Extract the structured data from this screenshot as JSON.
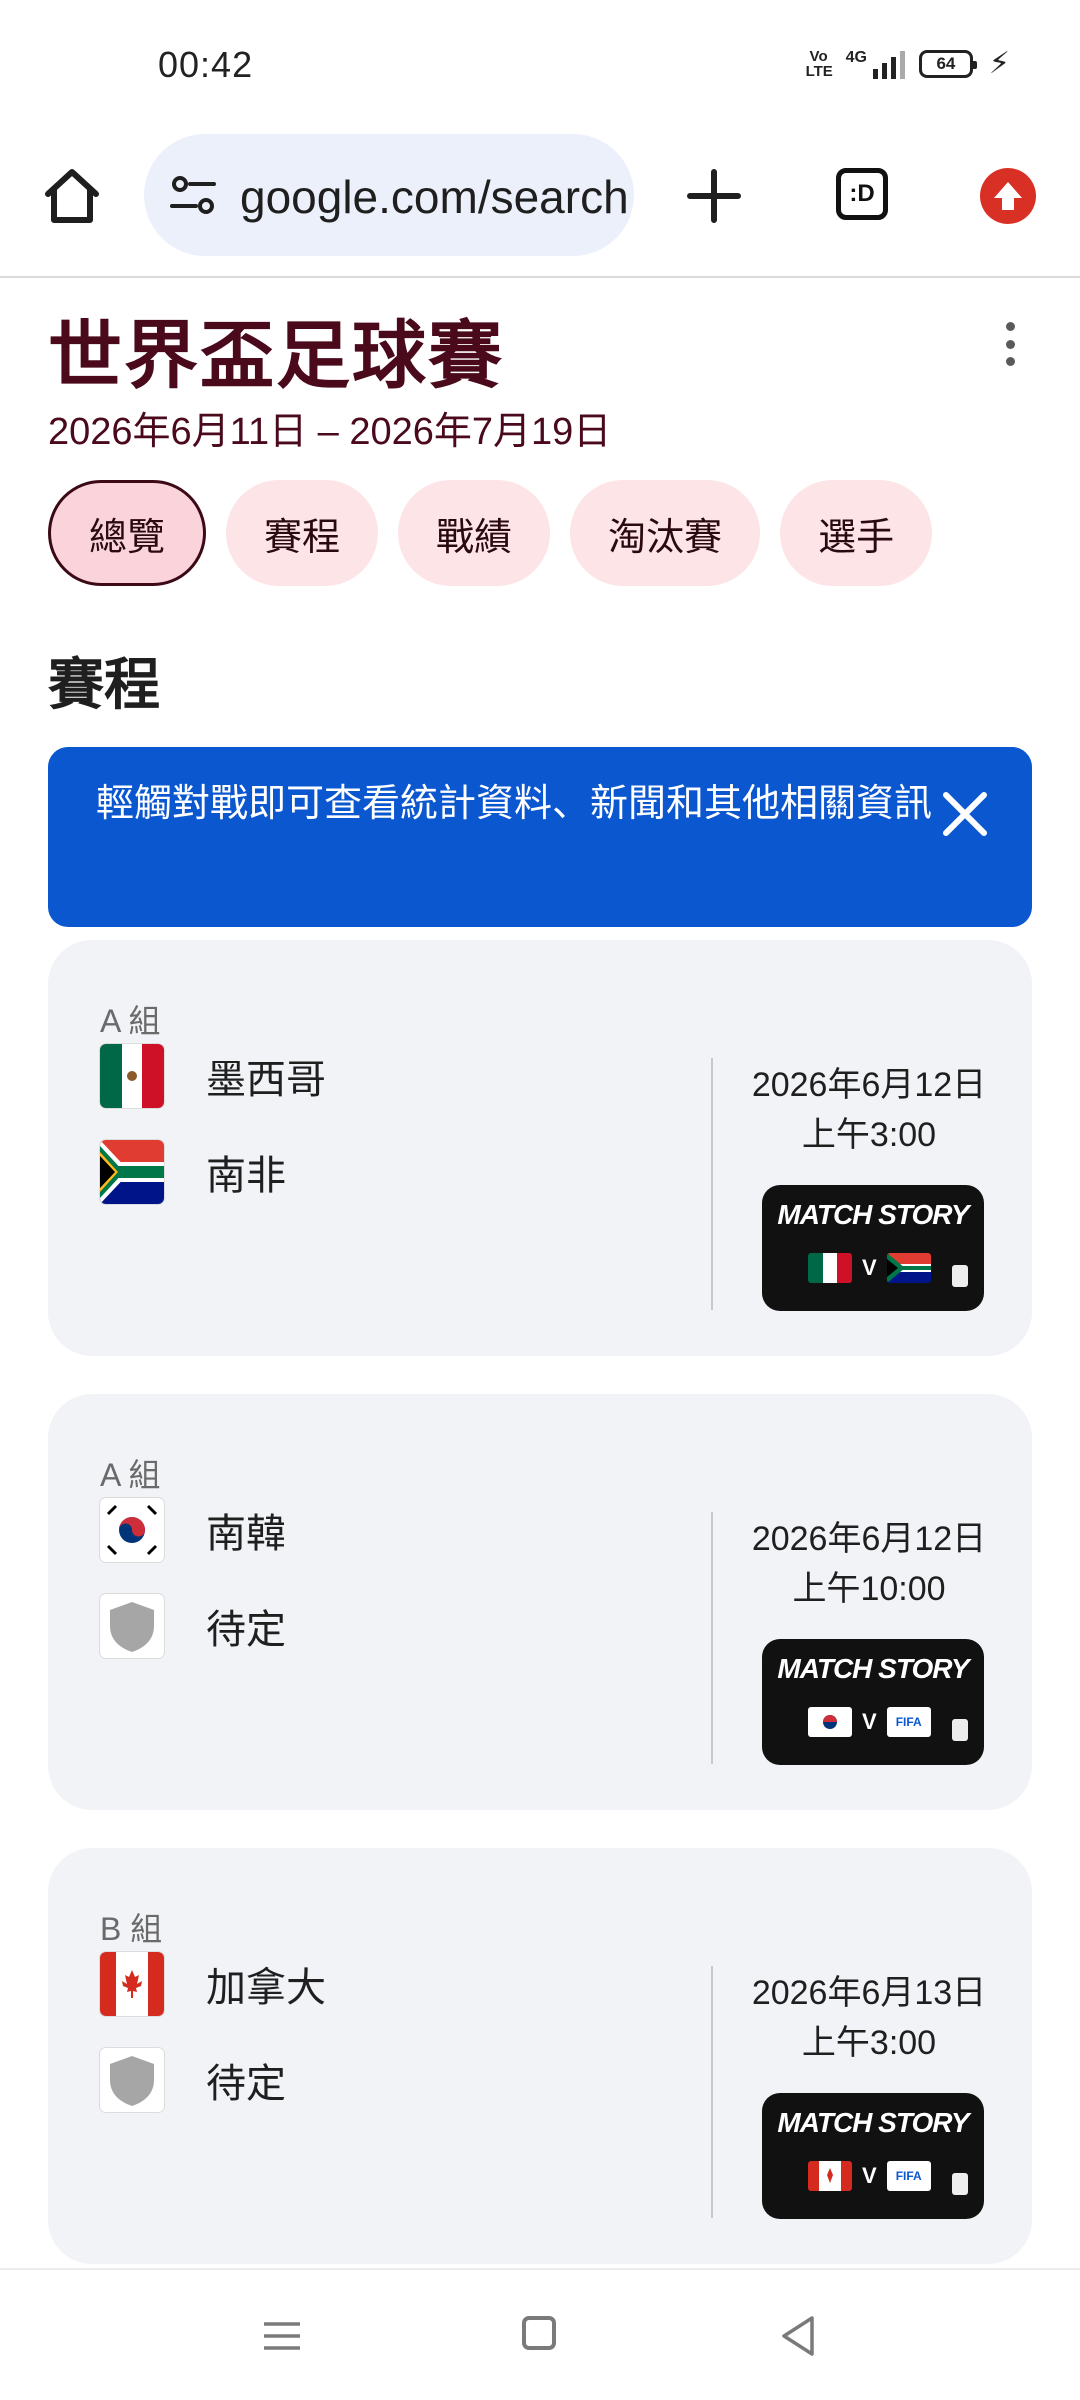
{
  "status_bar": {
    "time": "00:42",
    "volte": "Vo LTE",
    "network": "4G",
    "battery": "64"
  },
  "browser": {
    "url": "google.com/search"
  },
  "header": {
    "title": "世界盃足球賽",
    "date_range": "2026年6月11日 – 2026年7月19日"
  },
  "tabs": [
    {
      "label": "總覽",
      "active": true
    },
    {
      "label": "賽程",
      "active": false
    },
    {
      "label": "戰績",
      "active": false
    },
    {
      "label": "淘汰賽",
      "active": false
    },
    {
      "label": "選手",
      "active": false
    }
  ],
  "section": {
    "title": "賽程"
  },
  "banner": {
    "text": "輕觸對戰即可查看統計資料、新聞和其他相關資訊"
  },
  "matches": [
    {
      "group": "A 組",
      "team1": "墨西哥",
      "team1_flag": "mexico-flag-icon",
      "team2": "南非",
      "team2_flag": "south-africa-flag-icon",
      "date": "2026年6月12日",
      "time": "上午3:00",
      "story_label": "MATCH STORY"
    },
    {
      "group": "A 組",
      "team1": "南韓",
      "team1_flag": "south-korea-flag-icon",
      "team2": "待定",
      "team2_flag": "shield-placeholder-icon",
      "date": "2026年6月12日",
      "time": "上午10:00",
      "story_label": "MATCH STORY"
    },
    {
      "group": "B 組",
      "team1": "加拿大",
      "team1_flag": "canada-flag-icon",
      "team2": "待定",
      "team2_flag": "shield-placeholder-icon",
      "date": "2026年6月13日",
      "time": "上午3:00",
      "story_label": "MATCH STORY"
    }
  ],
  "colors": {
    "title": "#4a0a1c",
    "chip_bg": "#fde4e7",
    "banner_bg": "#0b57d0",
    "card_bg": "#f2f3f7",
    "update_badge": "#d93025"
  },
  "story_mini": {
    "v": "V",
    "fifa": "FIFA"
  }
}
